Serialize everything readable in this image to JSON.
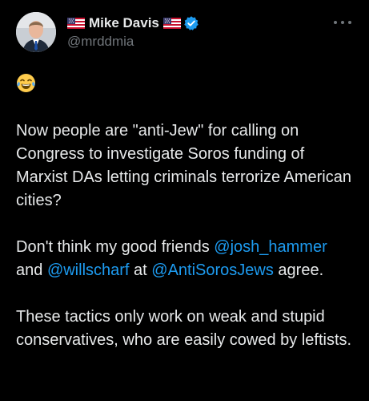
{
  "author": {
    "name": "Mike Davis",
    "handle": "@mrddmia",
    "icons": [
      "us-flag-icon",
      "us-flag-icon",
      "verified-badge-icon"
    ]
  },
  "more_icon": "more-options-icon",
  "emoji_icon": "face-with-tears-of-joy-icon",
  "colors": {
    "background": "#000000",
    "text": "#e7e9ea",
    "secondary_text": "#71767b",
    "mention": "#1d9bf0",
    "verified": "#1d9bf0"
  },
  "tweet": {
    "p1": "Now people are \"anti-Jew\" for calling on Congress to investigate Soros funding of Marxist DAs letting criminals terrorize American cities?",
    "p2_part1": "Don't think my good friends ",
    "p2_mention1": "@josh_hammer",
    "p2_part2": " and ",
    "p2_mention2": "@willscharf",
    "p2_part3": " at ",
    "p2_mention3": "@AntiSorosJews",
    "p2_part4": " agree.",
    "p3": "These tactics only work on weak and stupid conservatives, who are easily cowed by leftists."
  }
}
